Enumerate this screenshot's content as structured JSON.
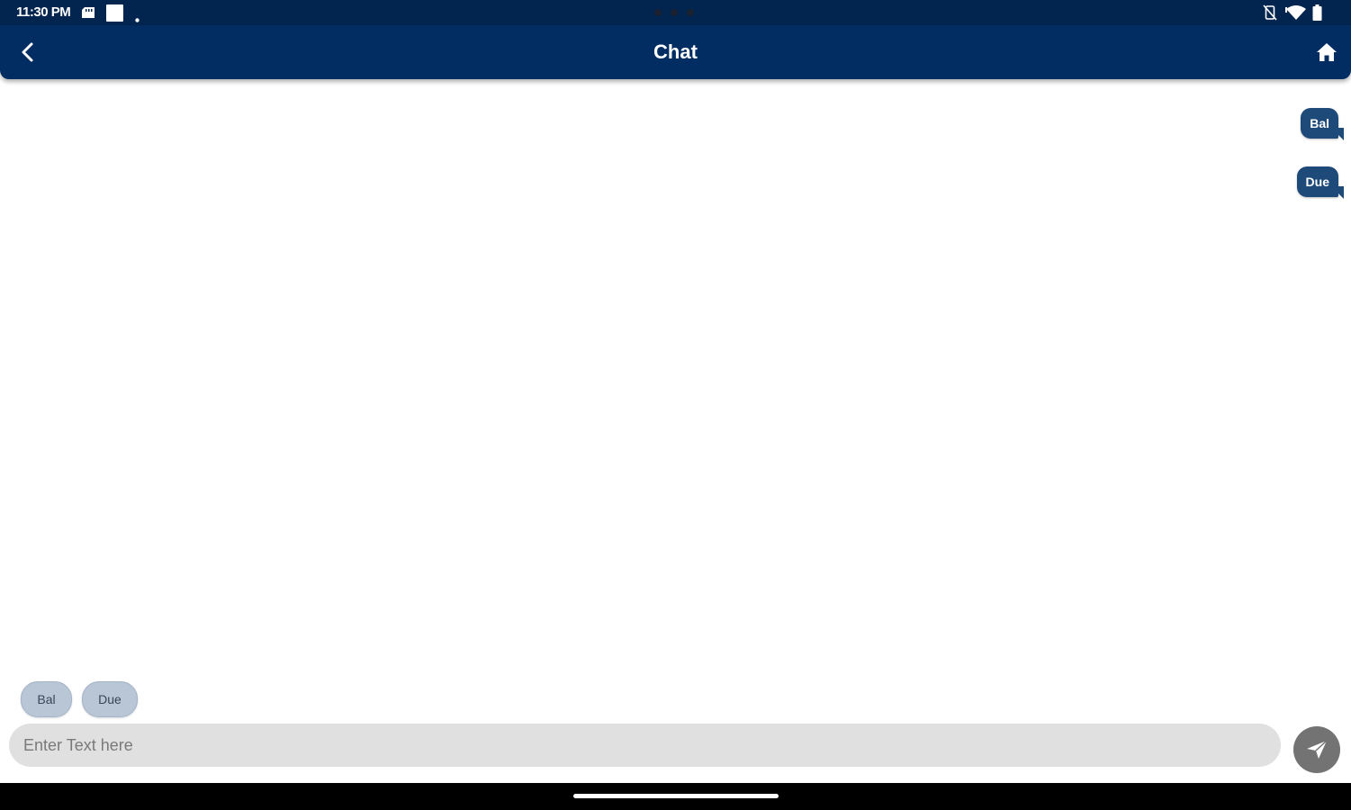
{
  "status_bar": {
    "time": "11:30 PM",
    "left_icons": [
      "sd-card-icon",
      "notification-square-icon",
      "dot-icon"
    ],
    "right_icons": [
      "vibrate-off-icon",
      "wifi-icon",
      "battery-icon"
    ]
  },
  "header": {
    "title": "Chat",
    "back_icon": "chevron-left-icon",
    "home_icon": "home-icon"
  },
  "messages": [
    {
      "text": "Bal",
      "sender": "user"
    },
    {
      "text": "Due",
      "sender": "user"
    }
  ],
  "quick_replies": [
    {
      "label": "Bal"
    },
    {
      "label": "Due"
    }
  ],
  "composer": {
    "placeholder": "Enter Text here",
    "value": "",
    "send_icon": "send-icon"
  },
  "colors": {
    "status_bar": "#02254f",
    "header": "#022d63",
    "bubble": "#1e4a7a",
    "chip": "#b9c6d6",
    "input_bg": "#e0e0e0",
    "send_button": "#737373",
    "nav_bar": "#000000"
  }
}
